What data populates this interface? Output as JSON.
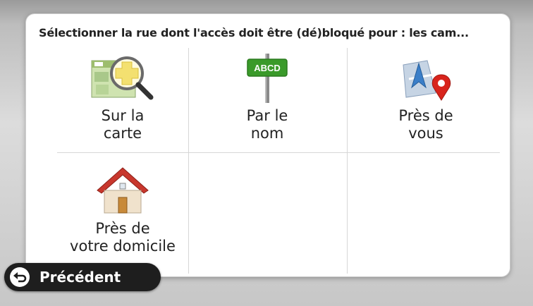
{
  "dialog": {
    "title": "Sélectionner la rue dont l'accès doit être (dé)bloqué pour : les cam..."
  },
  "options": [
    {
      "label": "Sur la\ncarte",
      "icon": "map-magnifier-icon"
    },
    {
      "label": "Par le\nnom",
      "icon": "street-sign-icon",
      "sign_text": "ABCD"
    },
    {
      "label": "Près de\nvous",
      "icon": "location-pin-icon"
    },
    {
      "label": "Près de\nvotre domicile",
      "icon": "home-icon"
    }
  ],
  "back_button": {
    "label": "Précédent",
    "icon": "back-arrow-icon"
  },
  "colors": {
    "sign_green": "#3a9a2a",
    "pin_red": "#d8241c",
    "roof_red": "#c8372d"
  }
}
